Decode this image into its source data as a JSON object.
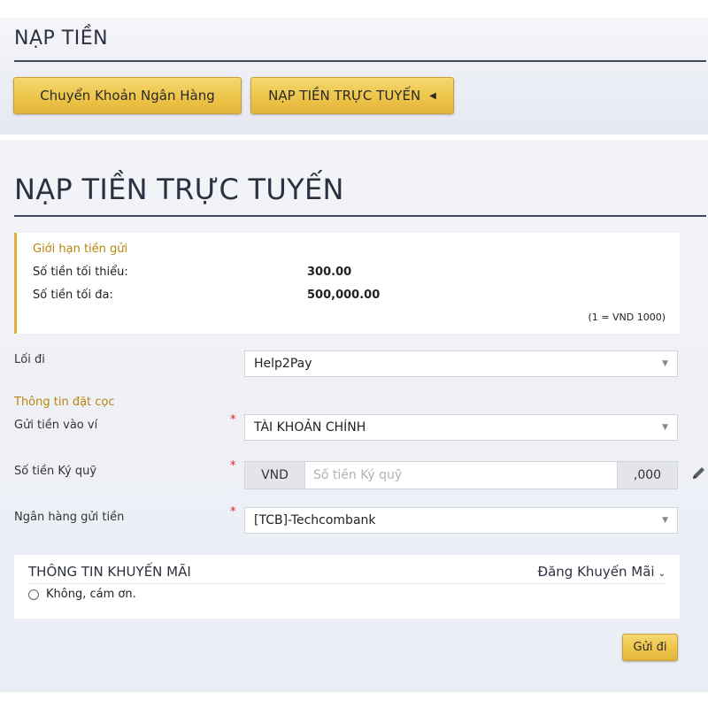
{
  "header": {
    "title": "NẠP TIỀN",
    "tabs": [
      {
        "label": "Chuyển Khoản Ngân Hàng"
      },
      {
        "label": "NẠP TIỀN TRỰC TUYẾN",
        "caret": "◀",
        "active": true
      }
    ]
  },
  "main": {
    "title": "NẠP TIỀN TRỰC TUYẾN"
  },
  "limits": {
    "title": "Giới hạn tiền gửi",
    "min_label": "Số tiền tối thiểu:",
    "min_value": "300.00",
    "max_label": "Số tiền tối đa:",
    "max_value": "500,000.00",
    "note": "(1 = VND 1000)"
  },
  "form": {
    "gateway_label": "Lối đi",
    "gateway_value": "Help2Pay",
    "deposit_section_label": "Thông tin đặt cọc",
    "wallet_label": "Gửi tiền vào ví",
    "wallet_value": "TÀI KHOẢN CHÍNH",
    "amount_label": "Số tiền Ký quỹ",
    "amount_currency": "VND",
    "amount_placeholder": "Số tiền Ký quỹ",
    "amount_value": "",
    "amount_suffix": ",000",
    "bank_label": "Ngân hàng gửi tiền",
    "bank_value": "[TCB]-Techcombank",
    "required_mark": "*",
    "dropdown_arrow": "▼"
  },
  "promo": {
    "title": "THÔNG TIN KHUYẾN MÃI",
    "register_link": "Đăng Khuyến Mãi",
    "register_chevron": "⌄",
    "option_label": "Không, cám ơn."
  },
  "submit": {
    "label": "Gửi đi"
  },
  "colors": {
    "accent_gold": "#edc54a",
    "section_label": "#b8860b",
    "required": "#e02020",
    "heading": "#2c3040"
  },
  "icons": {
    "tab_caret": "caret-left-icon",
    "dropdown": "chevron-down-icon",
    "edit": "pencil-icon",
    "radio": "radio-unchecked-icon"
  }
}
